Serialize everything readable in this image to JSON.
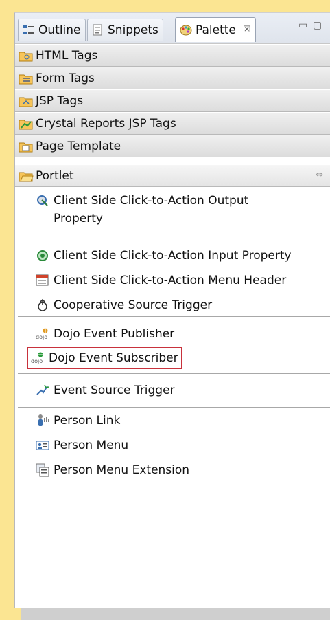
{
  "tabs": [
    {
      "label": "Outline",
      "icon": "outline-icon"
    },
    {
      "label": "Snippets",
      "icon": "snippets-icon"
    },
    {
      "label": "Palette",
      "icon": "palette-icon",
      "active": true
    }
  ],
  "tab_close_glyph": "☒",
  "window_controls": {
    "minimize": "▭",
    "maximize": "▢"
  },
  "drawers": [
    {
      "label": "HTML Tags",
      "icon": "html-tags-folder-icon"
    },
    {
      "label": "Form Tags",
      "icon": "form-tags-folder-icon"
    },
    {
      "label": "JSP Tags",
      "icon": "jsp-tags-folder-icon"
    },
    {
      "label": "Crystal Reports JSP Tags",
      "icon": "crystal-reports-folder-icon"
    },
    {
      "label": "Page Template",
      "icon": "page-template-folder-icon"
    },
    {
      "label": "Portlet",
      "icon": "portlet-folder-icon",
      "open": true
    }
  ],
  "portlet_entries": [
    {
      "label": "Client Side Click-to-Action Output Property",
      "line1": "Client Side Click-to-Action Output",
      "line2": "Property",
      "icon": "click-to-action-output-icon"
    },
    {
      "label": "Client Side Click-to-Action Input Property",
      "icon": "click-to-action-input-icon"
    },
    {
      "label": "Client Side Click-to-Action Menu Header",
      "icon": "menu-header-icon"
    },
    {
      "label": "Cooperative Source Trigger",
      "icon": "cooperative-trigger-icon"
    },
    {
      "label": "Dojo Event Publisher",
      "icon": "dojo-publisher-icon"
    },
    {
      "label": "Dojo Event Subscriber",
      "icon": "dojo-subscriber-icon",
      "selected": true
    },
    {
      "label": "Event Source Trigger",
      "icon": "event-source-trigger-icon"
    },
    {
      "label": "Person Link",
      "icon": "person-link-icon"
    },
    {
      "label": "Person Menu",
      "icon": "person-menu-icon"
    },
    {
      "label": "Person Menu Extension",
      "icon": "person-menu-extension-icon"
    }
  ],
  "colors": {
    "background": "#fbe592",
    "selection_border": "#c8323c",
    "drawer_icon": "#e8a11a"
  }
}
